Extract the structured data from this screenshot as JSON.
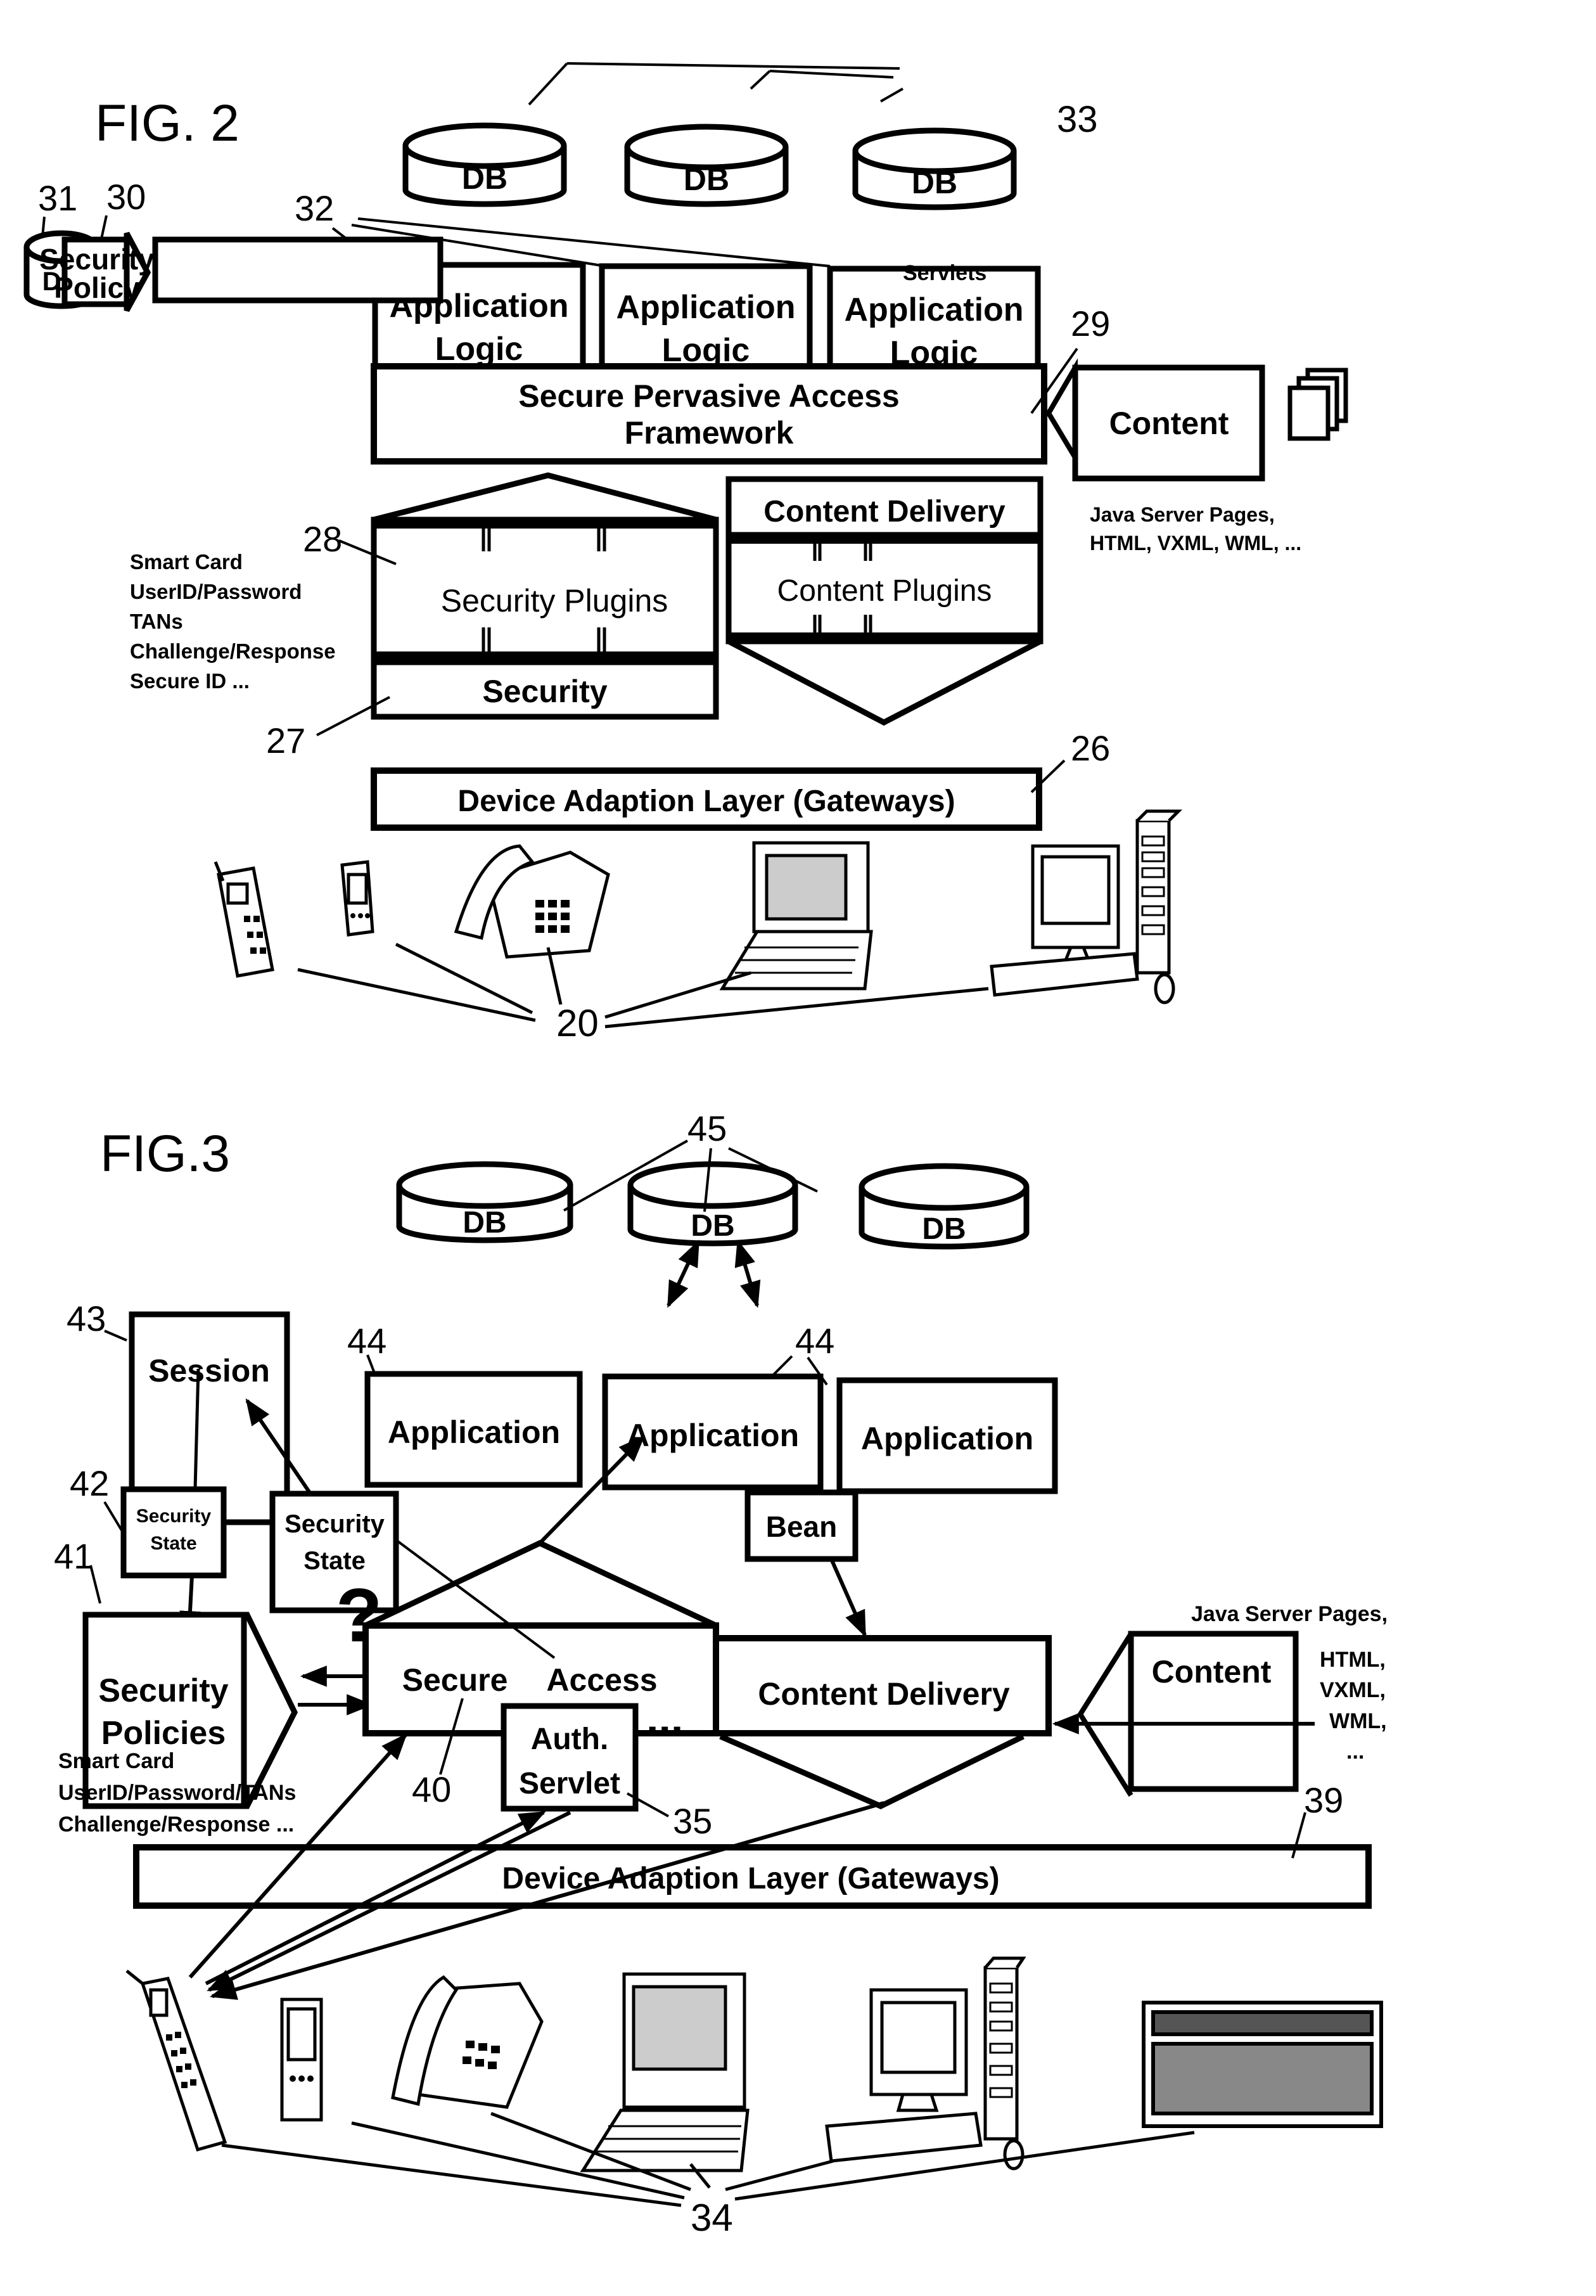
{
  "fig2": {
    "title": "FIG. 2",
    "databases": [
      {
        "label": "DB"
      },
      {
        "label": "DB"
      },
      {
        "label": "DB"
      }
    ],
    "db_ref": "33",
    "app_logic_ref": "32",
    "app_logic": [
      {
        "line1": "Application",
        "line2": "Logic"
      },
      {
        "line1": "Application",
        "line2": "Logic"
      },
      {
        "line1": "Application",
        "line2": "Logic"
      }
    ],
    "servlets_label": "Servlets",
    "policy_db": {
      "label": "DB",
      "ref": "31"
    },
    "security_policy": {
      "line1": "Security",
      "line2": "Policy",
      "ref": "30"
    },
    "framework": {
      "line1": "Secure Pervasive Access",
      "line2": "Framework",
      "ref": "29"
    },
    "content": {
      "label": "Content"
    },
    "content_formats": {
      "line1": "Java Server Pages,",
      "line2": "HTML, VXML, WML, ..."
    },
    "security_plugins": {
      "label": "Security Plugins",
      "ref": "28"
    },
    "security": {
      "label": "Security",
      "ref": "27"
    },
    "content_delivery": {
      "label": "Content Delivery"
    },
    "content_plugins": {
      "label": "Content Plugins"
    },
    "auth_methods": [
      "Smart Card",
      "UserID/Password",
      "TANs",
      "Challenge/Response",
      "Secure ID ..."
    ],
    "device_layer": {
      "label": "Device Adaption Layer (Gateways)",
      "ref": "26"
    },
    "devices_ref": "20",
    "devices": [
      "mobile-phone",
      "pda",
      "desk-phone",
      "laptop",
      "desktop-pc"
    ]
  },
  "fig3": {
    "title": "FIG.3",
    "databases": [
      {
        "label": "DB"
      },
      {
        "label": "DB"
      },
      {
        "label": "DB"
      }
    ],
    "db_ref": "45",
    "applications": [
      {
        "label": "Application"
      },
      {
        "label": "Application"
      },
      {
        "label": "Application"
      }
    ],
    "app_ref": "44",
    "session": {
      "label": "Session",
      "ref": "43"
    },
    "security_state_small": {
      "line1": "Security",
      "line2": "State",
      "ref": "42"
    },
    "security_state": {
      "line1": "Security",
      "line2": "State"
    },
    "bean": {
      "label": "Bean"
    },
    "question_mark": "?",
    "security_policies": {
      "line1": "Security",
      "line2": "Policies",
      "ref": "41"
    },
    "secure_access": {
      "word1": "Secure",
      "word2": "Access",
      "ref": "40"
    },
    "auth_servlet": {
      "line1": "Auth.",
      "line2": "Servlet",
      "ref": "35",
      "ellipsis": "..."
    },
    "content_delivery": {
      "label": "Content Delivery"
    },
    "content": {
      "label": "Content"
    },
    "content_formats": [
      "Java Server Pages,",
      "HTML,",
      "VXML,",
      "WML,",
      "..."
    ],
    "auth_methods": [
      "Smart Card",
      "UserID/Password/TANs",
      "Challenge/Response ..."
    ],
    "device_layer": {
      "label": "Device Adaption Layer (Gateways)",
      "ref": "39"
    },
    "devices_ref": "34",
    "devices": [
      "mobile-phone",
      "pda",
      "desk-phone",
      "laptop",
      "desktop-pc",
      "flat-panel-display"
    ]
  }
}
